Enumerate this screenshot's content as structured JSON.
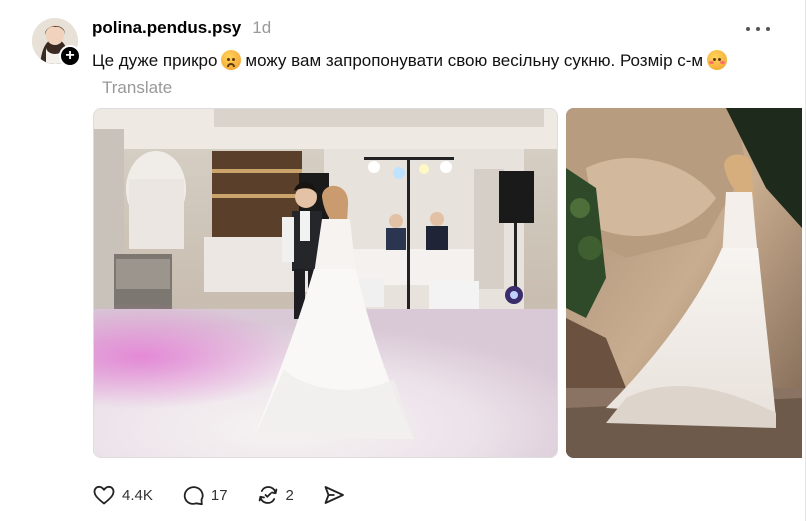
{
  "post": {
    "username": "polina.pendus.psy",
    "time": "1d",
    "caption_part1": "Це дуже прикро",
    "caption_part2": "можу вам запропонувати свою весільну сукню. Розмір с-м",
    "translate_label": "Translate",
    "follow_symbol": "+",
    "emojis": [
      "sad-face-emoji",
      "blushing-face-emoji"
    ]
  },
  "actions": {
    "likes": "4.4K",
    "replies": "17",
    "reposts": "2"
  },
  "icons": [
    "more-icon",
    "heart-icon",
    "comment-icon",
    "repost-icon",
    "share-icon"
  ]
}
